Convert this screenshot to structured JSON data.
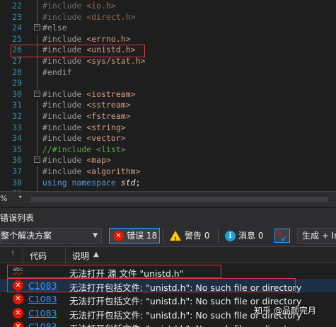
{
  "editor": {
    "lines": [
      {
        "num": "22",
        "parts": [
          {
            "cls": "pp",
            "t": "#include "
          },
          {
            "cls": "inc",
            "t": "<io.h>"
          }
        ],
        "state": "dim"
      },
      {
        "num": "23",
        "parts": [
          {
            "cls": "pp",
            "t": "#include "
          },
          {
            "cls": "inc",
            "t": "<direct.h>"
          }
        ],
        "state": "dim"
      },
      {
        "num": "24",
        "parts": [
          {
            "cls": "pp",
            "t": "#else"
          }
        ],
        "fold": "minus"
      },
      {
        "num": "25",
        "parts": [
          {
            "cls": "pp",
            "t": "#include "
          },
          {
            "cls": "inc",
            "t": "<errno.h>"
          }
        ]
      },
      {
        "num": "26",
        "parts": [
          {
            "cls": "pp",
            "t": "#include "
          },
          {
            "cls": "inc",
            "t": "<unistd.h>"
          }
        ],
        "highlight": true
      },
      {
        "num": "27",
        "parts": [
          {
            "cls": "pp",
            "t": "#include "
          },
          {
            "cls": "inc",
            "t": "<sys/stat.h>"
          }
        ]
      },
      {
        "num": "28",
        "parts": [
          {
            "cls": "pp",
            "t": "#endif"
          }
        ]
      },
      {
        "num": "29",
        "parts": []
      },
      {
        "num": "30",
        "parts": [
          {
            "cls": "pp",
            "t": "#include "
          },
          {
            "cls": "inc",
            "t": "<iostream>"
          }
        ],
        "fold": "minus"
      },
      {
        "num": "31",
        "parts": [
          {
            "cls": "pp",
            "t": "#include "
          },
          {
            "cls": "inc",
            "t": "<sstream>"
          }
        ]
      },
      {
        "num": "32",
        "parts": [
          {
            "cls": "pp",
            "t": "#include "
          },
          {
            "cls": "inc",
            "t": "<fstream>"
          }
        ]
      },
      {
        "num": "33",
        "parts": [
          {
            "cls": "pp",
            "t": "#include "
          },
          {
            "cls": "inc",
            "t": "<string>"
          }
        ]
      },
      {
        "num": "34",
        "parts": [
          {
            "cls": "pp",
            "t": "#include "
          },
          {
            "cls": "inc",
            "t": "<vector>"
          }
        ]
      },
      {
        "num": "35",
        "parts": [
          {
            "cls": "cmt",
            "t": "//#include <list>"
          }
        ]
      },
      {
        "num": "36",
        "parts": [
          {
            "cls": "pp",
            "t": "#include "
          },
          {
            "cls": "inc",
            "t": "<map>"
          }
        ],
        "fold": "minus"
      },
      {
        "num": "37",
        "parts": [
          {
            "cls": "pp",
            "t": "#include "
          },
          {
            "cls": "inc",
            "t": "<algorithm>"
          }
        ]
      },
      {
        "num": "38",
        "parts": [
          {
            "cls": "kw",
            "t": "using namespace "
          },
          {
            "cls": "ns",
            "t": "std"
          },
          {
            "cls": "plain",
            "t": ";"
          }
        ]
      },
      {
        "num": "39",
        "parts": []
      }
    ]
  },
  "zoom": {
    "value": "%"
  },
  "error_panel": {
    "title": "错误列表",
    "scope": "整个解决方案",
    "errors_label": "错误 18",
    "warnings_label": "警告 0",
    "messages_label": "消息 0",
    "build_filter": "生成 + In",
    "columns": {
      "code": "代码",
      "description": "说明"
    },
    "rows": [
      {
        "type": "spell",
        "code": "",
        "description": "无法打开 源 文件 \"unistd.h\""
      },
      {
        "type": "error",
        "code": "C1083",
        "description": "无法打开包括文件: \"unistd.h\": No such file or directory"
      },
      {
        "type": "error",
        "code": "C1083",
        "description": "无法打开包括文件: \"unistd.h\": No such file or directory"
      },
      {
        "type": "error",
        "code": "C1083",
        "description": "无法打开包括文件: \"unistd.h\": No such file or directory"
      },
      {
        "type": "error",
        "code": "C1083",
        "description": "无法打开包括文件: \"unistd.h\": No such file or directory"
      }
    ]
  },
  "watermark": "知乎 @品颜完月",
  "colors": {
    "error_red": "#e51400",
    "link_blue": "#3794ff",
    "annotation_red": "#d9363e"
  }
}
